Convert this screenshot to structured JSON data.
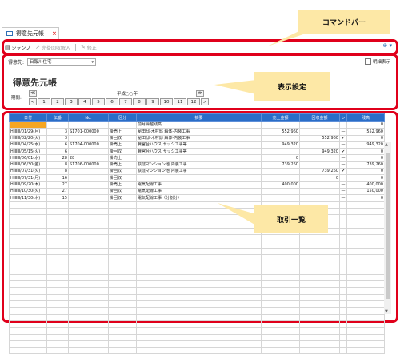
{
  "tab": {
    "label": "得意先元帳",
    "close": "×"
  },
  "toolbar": {
    "items": [
      {
        "icon": "▤",
        "label": "ジャンプ",
        "enabled": true
      },
      {
        "icon": "↗",
        "label": "売掛回収解入",
        "enabled": false
      },
      {
        "icon": "✎",
        "label": "修正",
        "enabled": false
      }
    ],
    "right_icon": "⊕ ▾"
  },
  "filter": {
    "label": "得意先:",
    "value": "日報川住宅",
    "checkbox_label": "明細表示"
  },
  "page_title": "得意先元帳",
  "period": {
    "label": "期間:",
    "year_label": "平成○○年",
    "prev_year": "≪",
    "next_year": "≫",
    "prev_month": "<",
    "next_month": ">",
    "months": [
      "1",
      "2",
      "3",
      "4",
      "5",
      "6",
      "7",
      "8",
      "9",
      "10",
      "11",
      "12"
    ]
  },
  "table": {
    "headers": [
      "日付",
      "伝番",
      "No.",
      "区分",
      "摘要",
      "売上金額",
      "回収金額",
      "レ",
      "残高"
    ],
    "rows": [
      {
        "date": "",
        "no": "",
        "code": "",
        "kind": "",
        "memo": "前月繰越残高",
        "sales": "",
        "recv": "",
        "chk": "",
        "bal": "0"
      },
      {
        "date": "H.ⅢⅢ/01/29(月)",
        "no": "3",
        "code": "S1701-000000",
        "kind": "掛売上",
        "memo": "秘田邸-木村邸 解体-内装工事",
        "sales": "552,960",
        "recv": "",
        "chk": "—",
        "bal": "552,960"
      },
      {
        "date": "H.ⅢⅢ/02/20(火)",
        "no": "3",
        "code": "",
        "kind": "掛回収",
        "memo": "秘田邸-木村邸 解体-内装工事",
        "sales": "",
        "recv": "552,960",
        "chk": "✔",
        "bal": "0"
      },
      {
        "date": "H.ⅢⅢ/04/25(水)",
        "no": "6",
        "code": "S1704-000000",
        "kind": "掛売上",
        "memo": "賢宮台ハウス サッシ工事等",
        "sales": "949,320",
        "recv": "",
        "chk": "—",
        "bal": "949,320"
      },
      {
        "date": "H.ⅢⅢ/05/15(火)",
        "no": "6",
        "code": "",
        "kind": "掛回収",
        "memo": "賢宮台ハウス サッシ工事等",
        "sales": "",
        "recv": "949,320",
        "chk": "✔",
        "bal": "0"
      },
      {
        "date": "H.ⅢⅢ/06/01(水)",
        "no": "28",
        "code": "28",
        "kind": "掛売上",
        "memo": "",
        "sales": "0",
        "recv": "",
        "chk": "—",
        "bal": "0"
      },
      {
        "date": "H.ⅢⅢ/06/30(金)",
        "no": "8",
        "code": "S1706-000000",
        "kind": "掛売上",
        "memo": "荻窪マンション池 内装工事",
        "sales": "739,260",
        "recv": "",
        "chk": "—",
        "bal": "739,260"
      },
      {
        "date": "H.ⅢⅢ/07/31(火)",
        "no": "8",
        "code": "",
        "kind": "掛回収",
        "memo": "荻窪マンション池 内装工事",
        "sales": "",
        "recv": "739,260",
        "chk": "✔",
        "bal": "0"
      },
      {
        "date": "H.ⅢⅢ/07/31(月)",
        "no": "16",
        "code": "",
        "kind": "掛回収",
        "memo": "",
        "sales": "",
        "recv": "0",
        "chk": "",
        "bal": "0"
      },
      {
        "date": "H.ⅢⅢ/09/20(木)",
        "no": "27",
        "code": "",
        "kind": "掛売上",
        "memo": "電気配線工事",
        "sales": "400,000",
        "recv": "",
        "chk": "—",
        "bal": "400,000"
      },
      {
        "date": "H.ⅢⅢ/10/30(火)",
        "no": "27",
        "code": "",
        "kind": "掛回収",
        "memo": "電気配線工事",
        "sales": "",
        "recv": "",
        "chk": "—",
        "bal": "150,000"
      },
      {
        "date": "H.ⅢⅢ/11/30(木)",
        "no": "15",
        "code": "",
        "kind": "掛回収",
        "memo": "電気配線工事（分割分）",
        "sales": "",
        "recv": "",
        "chk": "—",
        "bal": "0"
      }
    ],
    "empty_rows": 23
  },
  "callouts": {
    "command": "コマンドバー",
    "display": "表示設定",
    "list": "取引一覧"
  },
  "colors": {
    "accent": "#e0001b",
    "header": "#2a6dc8",
    "callout": "#fde8a6",
    "selected": "#f5a623"
  }
}
